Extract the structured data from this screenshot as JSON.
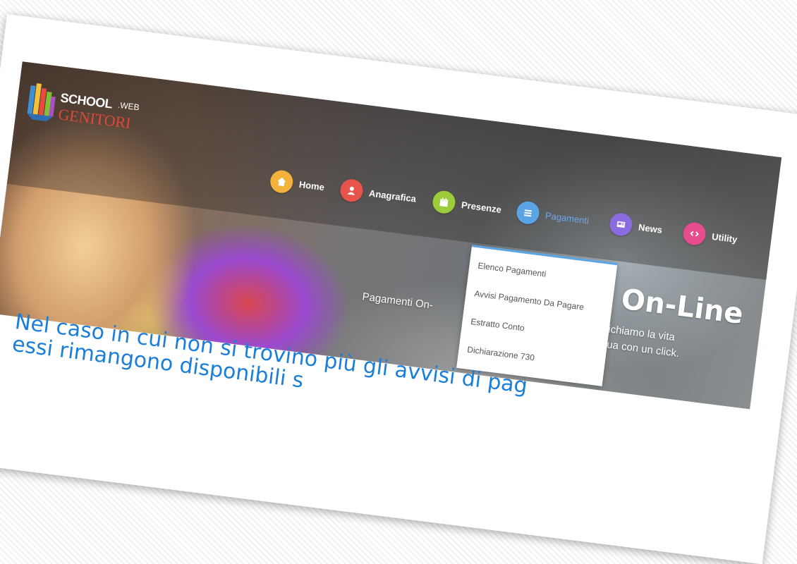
{
  "logo": {
    "school": "SCHOOL",
    "web": ".WEB",
    "genitori": "GENITORI"
  },
  "nav": {
    "items": [
      {
        "label": "Home",
        "icon": "home-icon",
        "color": "#f3b23c"
      },
      {
        "label": "Anagrafica",
        "icon": "user-icon",
        "color": "#e8534b"
      },
      {
        "label": "Presenze",
        "icon": "calendar-icon",
        "color": "#9ccc3c"
      },
      {
        "label": "Pagamenti",
        "icon": "list-icon",
        "color": "#5aa4e6",
        "active": true
      },
      {
        "label": "News",
        "icon": "newspaper-icon",
        "color": "#8b6be0"
      },
      {
        "label": "Utility",
        "icon": "link-icon",
        "color": "#e64d8c"
      }
    ]
  },
  "dropdown": {
    "items": [
      "Elenco Pagamenti",
      "Avvisi Pagamento Da Pagare",
      "Estratto Conto",
      "Dichiarazione 730"
    ]
  },
  "hero": {
    "title": "ti On-Line",
    "subtitle_line1": "mplifichiamo la vita",
    "subtitle_line2": "asa tua con un click.",
    "left_text": "Pagamenti On-"
  },
  "caption": {
    "line1": "Nel caso in cui non si trovino più gli avvisi di pag",
    "line2": "essi rimangono disponibili s"
  }
}
